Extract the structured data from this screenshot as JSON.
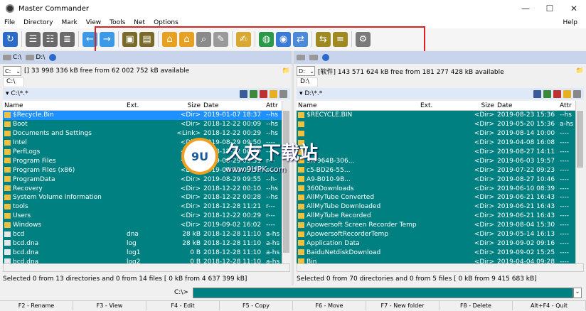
{
  "window": {
    "title": "Master Commander",
    "minimize": "—",
    "maximize": "☐",
    "close": "✕"
  },
  "menu": [
    "File",
    "Directory",
    "Mark",
    "View",
    "Tools",
    "Net",
    "Options"
  ],
  "menu_help": "Help",
  "toolbar_icons": [
    {
      "name": "refresh-icon",
      "color": "#2a6ac8",
      "glyph": "↻"
    },
    {
      "name": "brief-view-icon",
      "color": "#6a6a6a",
      "glyph": "☰"
    },
    {
      "name": "detail-view-icon",
      "color": "#6a6a6a",
      "glyph": "☷"
    },
    {
      "name": "tree-view-icon",
      "color": "#6a6a6a",
      "glyph": "≣"
    },
    {
      "name": "back-arrow-icon",
      "color": "#3a9ae8",
      "glyph": "←"
    },
    {
      "name": "forward-arrow-icon",
      "color": "#3a9ae8",
      "glyph": "→"
    },
    {
      "name": "pack-icon",
      "color": "#7a6a2a",
      "glyph": "▣"
    },
    {
      "name": "unpack-icon",
      "color": "#7a6a2a",
      "glyph": "▤"
    },
    {
      "name": "lock-icon",
      "color": "#e8a020",
      "glyph": "⌂"
    },
    {
      "name": "unlock-icon",
      "color": "#e8a020",
      "glyph": "⌂"
    },
    {
      "name": "search-icon",
      "color": "#8a8a8a",
      "glyph": "⌕"
    },
    {
      "name": "edit-pen-icon",
      "color": "#9a9a9a",
      "glyph": "✎"
    },
    {
      "name": "notepad-icon",
      "color": "#d8a830",
      "glyph": "✍"
    },
    {
      "name": "network-globe-icon",
      "color": "#2a9a4a",
      "glyph": "◍"
    },
    {
      "name": "ftp-globe-icon",
      "color": "#3a7ad8",
      "glyph": "◉"
    },
    {
      "name": "sync-icon",
      "color": "#4a8ad8",
      "glyph": "⇄"
    },
    {
      "name": "compare-icon",
      "color": "#a08a20",
      "glyph": "⇆"
    },
    {
      "name": "list-compare-icon",
      "color": "#a08a20",
      "glyph": "≡"
    },
    {
      "name": "settings-gear-icon",
      "color": "#7a7a7a",
      "glyph": "⚙"
    }
  ],
  "left": {
    "drive_c": "C:\\",
    "drive_d": "D:\\",
    "drive_select": "C:",
    "free_text": "[] 33 998 336 kB free from 62 002 752 kB available",
    "path_tab": "C:\\",
    "path": "▾ C:\\*.*",
    "columns": [
      "Name",
      "Ext.",
      "Size",
      "Date",
      "Attr"
    ],
    "rows": [
      {
        "name": "$Recycle.Bin",
        "ext": "",
        "size": "<Dir>",
        "date": "2019-01-07 18:37",
        "attr": "--hs",
        "sel": true,
        "dir": true
      },
      {
        "name": "Boot",
        "ext": "",
        "size": "<Dir>",
        "date": "2018-12-22 00:09",
        "attr": "--hs",
        "sel": false,
        "dir": true
      },
      {
        "name": "Documents and Settings",
        "ext": "",
        "size": "<Link>",
        "date": "2018-12-22 00:29",
        "attr": "--hs",
        "sel": false,
        "dir": true
      },
      {
        "name": "Intel",
        "ext": "",
        "size": "<Dir>",
        "date": "2019-08-29 09:50",
        "attr": "----",
        "sel": false,
        "dir": true
      },
      {
        "name": "PerfLogs",
        "ext": "",
        "size": "<Dir>",
        "date": "2018-12-22 00:09",
        "attr": "----",
        "sel": false,
        "dir": true
      },
      {
        "name": "Program Files",
        "ext": "",
        "size": "<Dir>",
        "date": "2019-08-29 09:51",
        "attr": "r---",
        "sel": false,
        "dir": true
      },
      {
        "name": "Program Files (x86)",
        "ext": "",
        "size": "<Dir>",
        "date": "2019-08-29 09:53",
        "attr": "r---",
        "sel": false,
        "dir": true
      },
      {
        "name": "ProgramData",
        "ext": "",
        "size": "<Dir>",
        "date": "2019-08-29 09:55",
        "attr": "--h-",
        "sel": false,
        "dir": true
      },
      {
        "name": "Recovery",
        "ext": "",
        "size": "<Dir>",
        "date": "2018-12-22 00:10",
        "attr": "--hs",
        "sel": false,
        "dir": true
      },
      {
        "name": "System Volume Information",
        "ext": "",
        "size": "<Dir>",
        "date": "2018-12-22 00:28",
        "attr": "--hs",
        "sel": false,
        "dir": true
      },
      {
        "name": "tools",
        "ext": "",
        "size": "<Dir>",
        "date": "2018-12-28 11:21",
        "attr": "r---",
        "sel": false,
        "dir": true
      },
      {
        "name": "Users",
        "ext": "",
        "size": "<Dir>",
        "date": "2018-12-22 00:29",
        "attr": "r---",
        "sel": false,
        "dir": true
      },
      {
        "name": "Windows",
        "ext": "",
        "size": "<Dir>",
        "date": "2019-09-02 16:02",
        "attr": "----",
        "sel": false,
        "dir": true
      },
      {
        "name": "bcd",
        "ext": "dna",
        "size": "28 kB",
        "date": "2018-12-28 11:10",
        "attr": "a-hs",
        "sel": false,
        "dir": false
      },
      {
        "name": "bcd.dna",
        "ext": "log",
        "size": "28 kB",
        "date": "2018-12-28 11:10",
        "attr": "a-hs",
        "sel": false,
        "dir": false
      },
      {
        "name": "bcd.dna",
        "ext": "log1",
        "size": "0 B",
        "date": "2018-12-28 11:10",
        "attr": "a-hs",
        "sel": false,
        "dir": false
      },
      {
        "name": "bcd.dna",
        "ext": "log2",
        "size": "0 B",
        "date": "2018-12-28 11:10",
        "attr": "a-hs",
        "sel": false,
        "dir": false
      }
    ],
    "status": "Selected 0 from 13 directories and 0 from 14 files [ 0 kB from 4 637 399 kB]"
  },
  "right": {
    "drive_select": "D:",
    "free_text": "[软件] 143 571 624 kB free from 181 277 428 kB available",
    "path_tab": "D:\\",
    "path": "▾ D:\\*.*",
    "columns": [
      "Name",
      "Ext.",
      "Size",
      "Date",
      "Attr"
    ],
    "rows": [
      {
        "name": "$RECYCLE.BIN",
        "ext": "",
        "size": "<Dir>",
        "date": "2019-08-23 15:36",
        "attr": "--hs",
        "sel": false,
        "dir": true
      },
      {
        "name": "",
        "ext": "",
        "size": "<Dir>",
        "date": "2019-05-20 15:36",
        "attr": "a-hs",
        "sel": false,
        "dir": true
      },
      {
        "name": "",
        "ext": "",
        "size": "<Dir>",
        "date": "2019-08-14 10:00",
        "attr": "----",
        "sel": false,
        "dir": true
      },
      {
        "name": "",
        "ext": "",
        "size": "<Dir>",
        "date": "2019-04-08 16:08",
        "attr": "----",
        "sel": false,
        "dir": true
      },
      {
        "name": "",
        "ext": "",
        "size": "<Dir>",
        "date": "2019-08-27 14:11",
        "attr": "----",
        "sel": false,
        "dir": true
      },
      {
        "name": "5A-964B-306...",
        "ext": "",
        "size": "<Dir>",
        "date": "2019-06-03 19:57",
        "attr": "----",
        "sel": false,
        "dir": true
      },
      {
        "name": "c5-BD26-55...",
        "ext": "",
        "size": "<Dir>",
        "date": "2019-07-22 09:23",
        "attr": "----",
        "sel": false,
        "dir": true
      },
      {
        "name": "A9-B010-9B...",
        "ext": "",
        "size": "<Dir>",
        "date": "2019-08-27 10:46",
        "attr": "----",
        "sel": false,
        "dir": true
      },
      {
        "name": "360Downloads",
        "ext": "",
        "size": "<Dir>",
        "date": "2019-06-10 08:39",
        "attr": "----",
        "sel": false,
        "dir": true
      },
      {
        "name": "AllMyTube Converted",
        "ext": "",
        "size": "<Dir>",
        "date": "2019-06-21 16:43",
        "attr": "----",
        "sel": false,
        "dir": true
      },
      {
        "name": "AllMyTube Downloaded",
        "ext": "",
        "size": "<Dir>",
        "date": "2019-06-21 16:43",
        "attr": "----",
        "sel": false,
        "dir": true
      },
      {
        "name": "AllMyTube Recorded",
        "ext": "",
        "size": "<Dir>",
        "date": "2019-06-21 16:43",
        "attr": "----",
        "sel": false,
        "dir": true
      },
      {
        "name": "Apowersoft Screen Recorder Temp",
        "ext": "",
        "size": "<Dir>",
        "date": "2019-08-04 15:30",
        "attr": "----",
        "sel": false,
        "dir": true
      },
      {
        "name": "ApowersoftRecorderTemp",
        "ext": "",
        "size": "<Dir>",
        "date": "2019-05-14 16:13",
        "attr": "----",
        "sel": false,
        "dir": true
      },
      {
        "name": "Application Data",
        "ext": "",
        "size": "<Dir>",
        "date": "2019-09-02 09:16",
        "attr": "----",
        "sel": false,
        "dir": true
      },
      {
        "name": "BaiduNetdiskDownload",
        "ext": "",
        "size": "<Dir>",
        "date": "2019-09-02 15:25",
        "attr": "----",
        "sel": false,
        "dir": true
      },
      {
        "name": "Bin",
        "ext": "",
        "size": "<Dir>",
        "date": "2019-04-04 09:28",
        "attr": "----",
        "sel": false,
        "dir": true
      }
    ],
    "status": "Selected 0 from 70 directories and 0 from 5 files [ 0 kB from 9 415 683 kB]"
  },
  "cmd_label": "C:\\>",
  "fkeys": [
    "F2 - Rename",
    "F3 - View",
    "F4 - Edit",
    "F5 - Copy",
    "F6 - Move",
    "F7 - New folder",
    "F8 - Delete",
    "Alt+F4 - Quit"
  ],
  "watermark": {
    "logo": "9U",
    "title": "久友下载站",
    "url": "www.9UPK.com"
  }
}
